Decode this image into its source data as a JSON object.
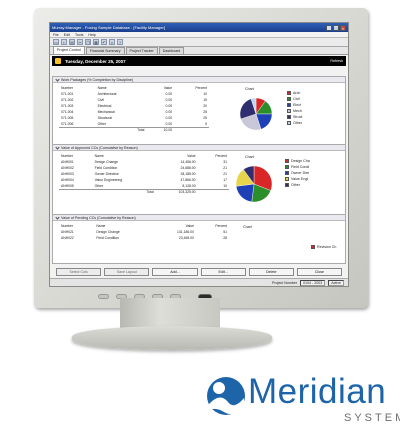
{
  "window": {
    "title": "Murray Manager - Foxing Sample Database - [Facility Manager]"
  },
  "menu": [
    "File",
    "Edit",
    "Tools",
    "Help"
  ],
  "toolbar_icons": [
    "open-icon",
    "save-icon",
    "print-icon",
    "cut-icon",
    "copy-icon",
    "paste-icon",
    "undo-icon",
    "search-icon",
    "help-icon"
  ],
  "tabs": [
    "Project Control",
    "Financial Summary",
    "Project Tracker",
    "Dashboard"
  ],
  "header": {
    "date": "Tuesday, December 25, 2007",
    "refresh": "Refresh"
  },
  "sections": [
    {
      "title": "Work Packages (% Completion by Discipline)",
      "columns": [
        "Number",
        "Name",
        "Value",
        "Percent",
        "Chart"
      ],
      "rows": [
        [
          "071-001",
          "Architectural",
          "0.00",
          "10"
        ],
        [
          "071-002",
          "Civil",
          "0.00",
          "15"
        ],
        [
          "071-003",
          "Electrical",
          "0.00",
          "20"
        ],
        [
          "071-004",
          "Mechanical",
          "0.00",
          "25"
        ],
        [
          "071-005",
          "Structural",
          "0.00",
          "25"
        ],
        [
          "071-006",
          "Other",
          "0.00",
          "5"
        ]
      ],
      "total_label": "Total",
      "total_value": "10.00",
      "legend": [
        "Arch",
        "Civil",
        "Elect",
        "Mech",
        "Struct",
        "Other"
      ],
      "colors": [
        "#d92727",
        "#2a8e2a",
        "#1f3fb6",
        "#c7c7d8",
        "#2f2f6f",
        "#b9d8f0"
      ]
    },
    {
      "title": "Value of Approved CCs (Cumulative by Reason)",
      "columns": [
        "Number",
        "Name",
        "Value",
        "Percent",
        "Chart"
      ],
      "rows": [
        [
          "ANH001",
          "Design Change",
          "14,456.00",
          "31"
        ],
        [
          "ANH002",
          "Field Condition",
          "24,688.00",
          "21"
        ],
        [
          "ANH003",
          "Owner Directive",
          "28,185.00",
          "21"
        ],
        [
          "ANH004",
          "Value Engineering",
          "47,866.00",
          "17"
        ],
        [
          "ANH005",
          "Other",
          "8,128.00",
          "10"
        ]
      ],
      "total_label": "Total",
      "total_value": "103,325.00",
      "legend": [
        "Design Cha",
        "Field Condi",
        "Owner Dire",
        "Value Engi",
        "Other"
      ],
      "colors": [
        "#d92727",
        "#2a8e2a",
        "#1f3fb6",
        "#e8d44a",
        "#2f2f6f"
      ]
    },
    {
      "title": "Value of Pending CCs (Cumulative by Reason)",
      "columns": [
        "Number",
        "Name",
        "Value",
        "Percent",
        "Chart"
      ],
      "rows": [
        [
          "ANH021",
          "Design Change",
          "131,186.00",
          "51"
        ],
        [
          "ANH022",
          "Field Condition",
          "23,465.00",
          "28"
        ]
      ]
    }
  ],
  "partial_legend_item": "Revision Ch",
  "buttons": [
    "Select Cols",
    "Save Layout",
    "Add...",
    "Edit...",
    "Delete",
    "Close"
  ],
  "enabled_buttons": [
    2,
    3,
    4,
    5
  ],
  "status": {
    "label": "Project Number",
    "value": "0104 - 2003",
    "mode": "Active"
  },
  "brand": {
    "name": "Meridian",
    "sub": "SYSTEMS",
    "color": "#1e64a8"
  }
}
